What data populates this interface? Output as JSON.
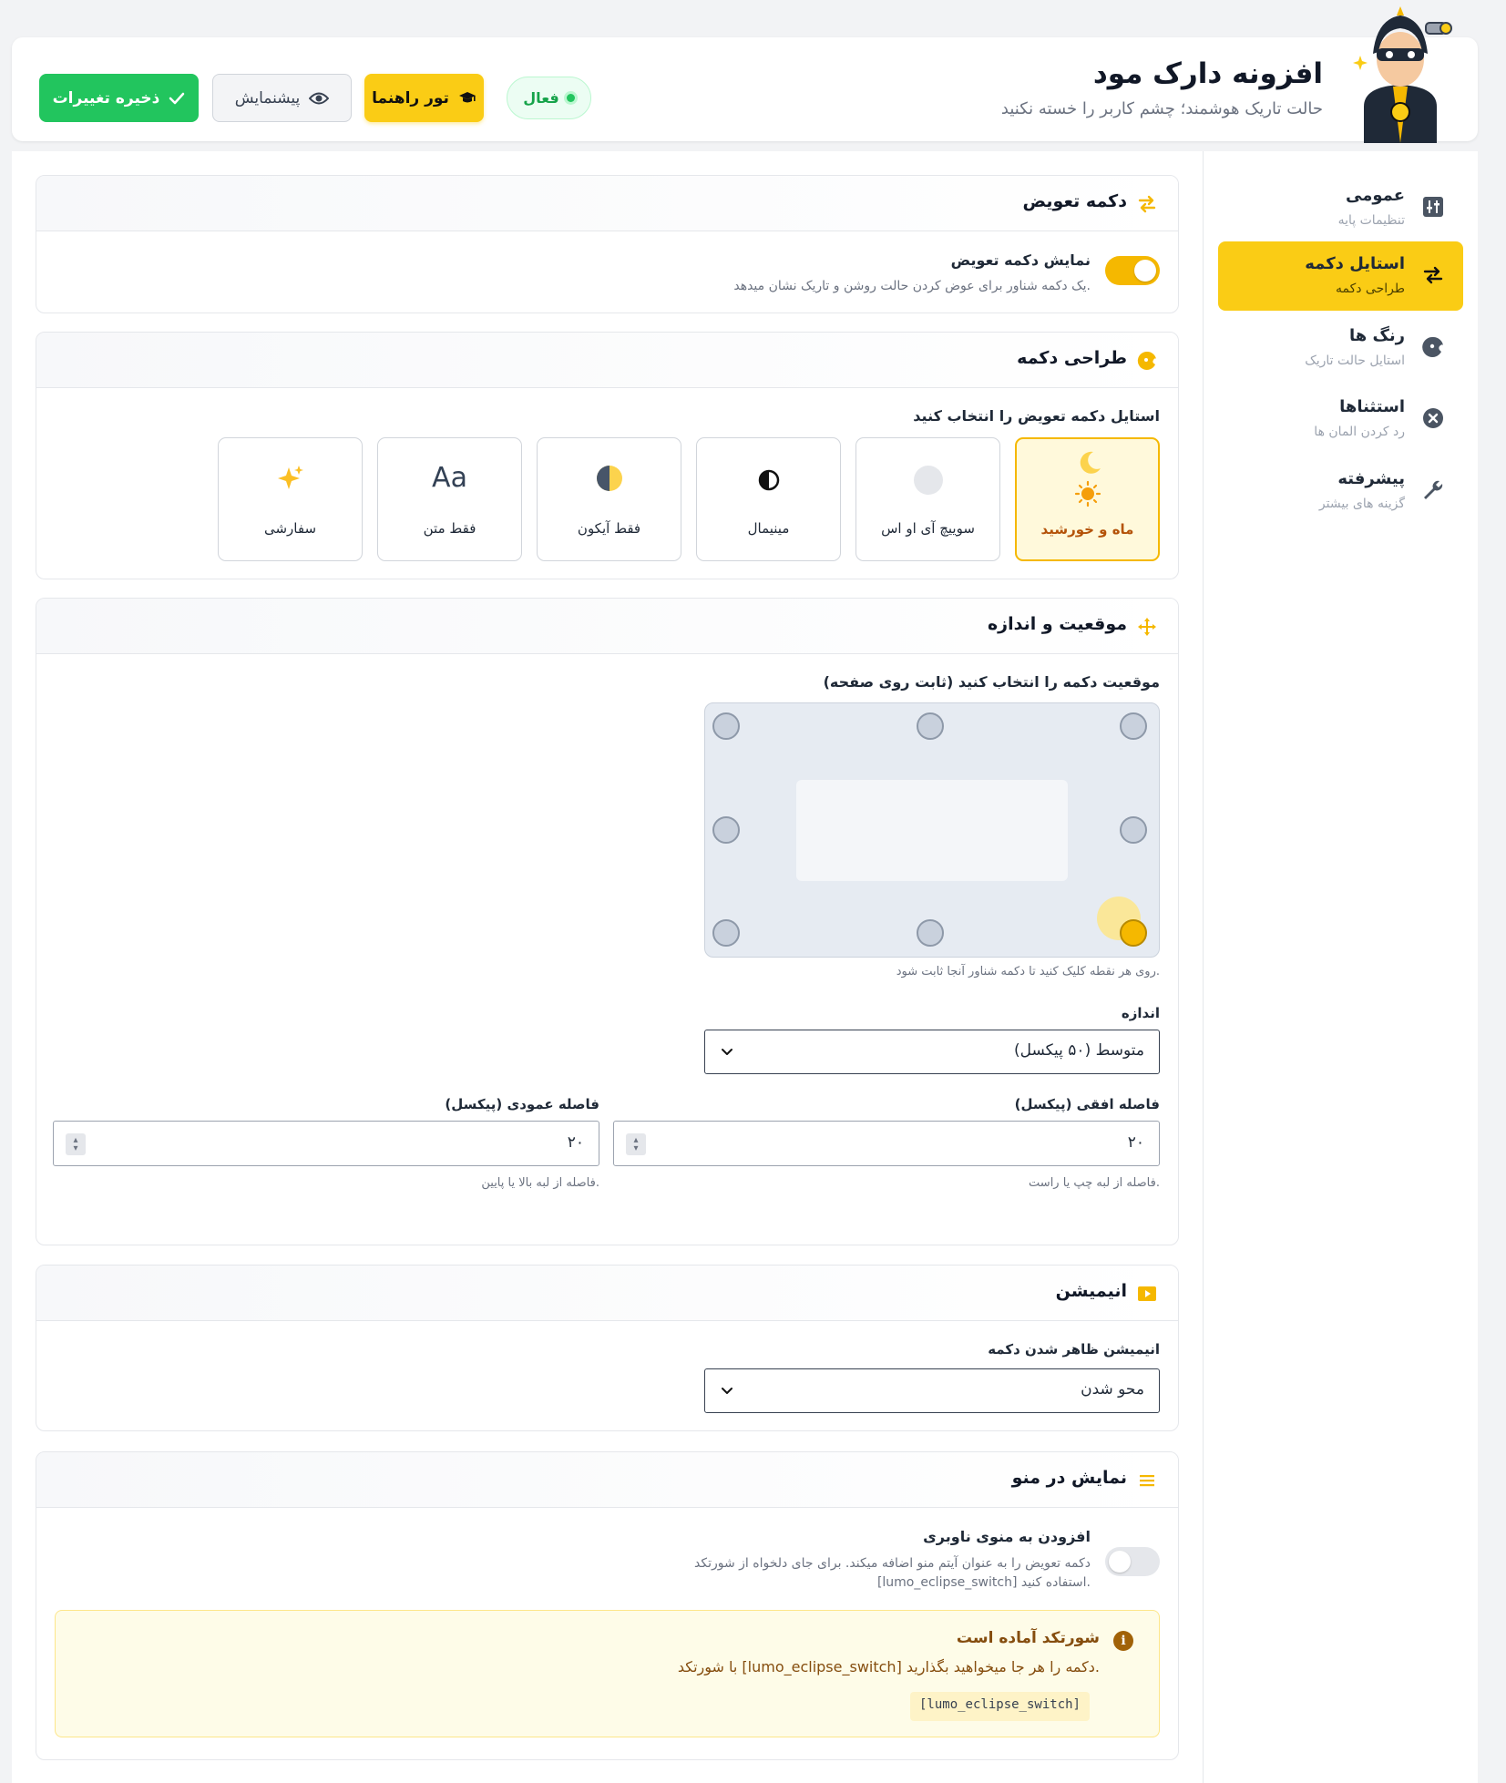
{
  "header": {
    "title": "افزونه دارک مود",
    "subtitle": "حالت تاریک هوشمند؛ چشم کاربر را خسته نکنید",
    "status_badge": "فعال",
    "tour_button": "تور راهنما",
    "preview_button": "پیشنمایش",
    "save_button": "ذخیره تغییرات"
  },
  "sidebar": {
    "items": [
      {
        "title": "عمومی",
        "subtitle": "تنظیمات پایه",
        "icon": "sliders-icon"
      },
      {
        "title": "استایل دکمه",
        "subtitle": "طراحی دکمه",
        "icon": "swap-icon",
        "active": true
      },
      {
        "title": "رنگ ها",
        "subtitle": "استایل حالت تاریک",
        "icon": "palette-icon"
      },
      {
        "title": "استثناها",
        "subtitle": "رد کردن المان ها",
        "icon": "x-circle-icon"
      },
      {
        "title": "پیشرفته",
        "subtitle": "گزینه های بیشتر",
        "icon": "wrench-icon"
      }
    ]
  },
  "toggle_section": {
    "title": "دکمه تعویض",
    "toggle_label": "نمایش دکمه تعویض",
    "toggle_desc": "یک دکمه شناور برای عوض کردن حالت روشن و تاریک نشان میدهد.",
    "enabled": true
  },
  "design_section": {
    "title": "طراحی دکمه",
    "prompt": "استایل دکمه تعویض را انتخاب کنید",
    "options": [
      {
        "label": "ماه و خورشید",
        "active": true
      },
      {
        "label": "سوییچ آی او اس"
      },
      {
        "label": "مینیمال"
      },
      {
        "label": "فقط آیکون"
      },
      {
        "label": "فقط متن",
        "glyph": "Aa"
      },
      {
        "label": "سفارشی"
      }
    ]
  },
  "position_section": {
    "title": "موقعیت و اندازه",
    "prompt": "موقعیت دکمه را انتخاب کنید (ثابت روی صفحه)",
    "grid_help": "روی هر نقطه کلیک کنید تا دکمه شناور آنجا ثابت شود.",
    "selected_position": "bottom-right",
    "size_label": "اندازه",
    "size_value": "متوسط (۵۰ پیکسل)",
    "horizontal_label": "فاصله افقی (پیکسل)",
    "horizontal_value": "۲۰",
    "horizontal_help": "فاصله از لبه چپ یا راست.",
    "vertical_label": "فاصله عمودی (پیکسل)",
    "vertical_value": "۲۰",
    "vertical_help": "فاصله از لبه بالا یا پایین."
  },
  "animation_section": {
    "title": "انیمیشن",
    "label": "انیمیشن ظاهر شدن دکمه",
    "value": "محو شدن"
  },
  "menu_section": {
    "title": "نمایش در منو",
    "toggle_label": "افزودن به منوی ناوبری",
    "toggle_desc_1": "دکمه تعویض را به عنوان آیتم منو اضافه میکند. برای جای دلخواه از شورتکد",
    "toggle_desc_2": "[lumo_eclipse_switch] استفاده کنید.",
    "enabled": false,
    "alert_title": "شورتکد آماده است",
    "alert_text": "با شورتکد [lumo_eclipse_switch] دکمه را هر جا میخواهید بگذارید.",
    "alert_code": "[lumo_eclipse_switch]"
  },
  "colors": {
    "accent": "#facc15",
    "success": "#22c55e"
  }
}
